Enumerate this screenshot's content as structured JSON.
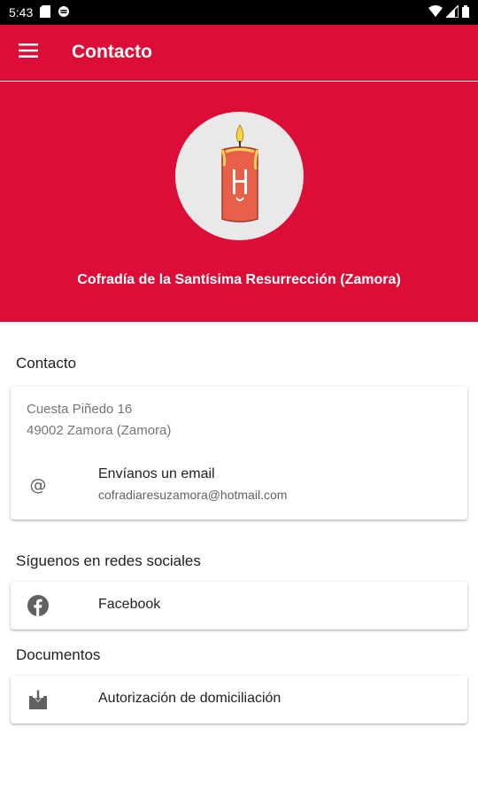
{
  "status_bar": {
    "time": "5:43"
  },
  "app_bar": {
    "title": "Contacto"
  },
  "hero": {
    "org_name": "Cofradía de la Santísima Resurrección (Zamora)"
  },
  "contact": {
    "section_title": "Contacto",
    "address_line1": "Cuesta Piñedo 16",
    "address_line2": "49002 Zamora (Zamora)",
    "email_label": "Envíanos un email",
    "email_address": "cofradiaresuzamora@hotmail.com",
    "email_icon": "at-icon"
  },
  "social": {
    "section_title": "Síguenos en redes sociales",
    "facebook_label": "Facebook",
    "facebook_icon": "facebook-icon"
  },
  "documents": {
    "section_title": "Documentos",
    "doc_label": "Autorización de domiciliación",
    "doc_icon": "download-icon"
  },
  "colors": {
    "primary": "#dc0d37",
    "logo_bg": "#e9e9e9"
  }
}
